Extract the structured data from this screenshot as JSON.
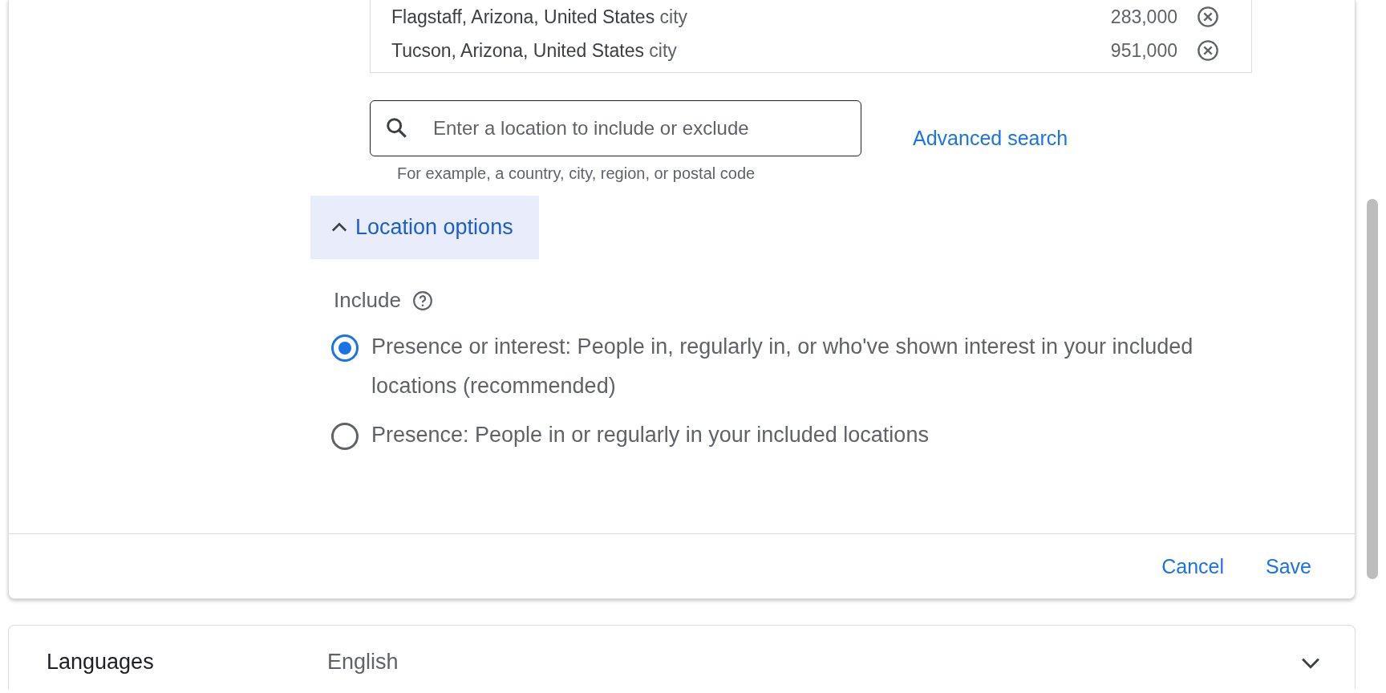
{
  "locations": [
    {
      "name": "Flagstaff, Arizona, United States",
      "type": "city",
      "reach": "283,000"
    },
    {
      "name": "Tucson, Arizona, United States",
      "type": "city",
      "reach": "951,000"
    }
  ],
  "search": {
    "placeholder": "Enter a location to include or exclude",
    "helper": "For example, a country, city, region, or postal code"
  },
  "advanced_search": "Advanced search",
  "location_options": {
    "label": "Location options",
    "expanded": true
  },
  "include": {
    "label": "Include",
    "options": [
      {
        "label": "Presence or interest: People in, regularly in, or who've shown interest in your included locations (recommended)",
        "selected": true
      },
      {
        "label": "Presence: People in or regularly in your included locations",
        "selected": false
      }
    ]
  },
  "buttons": [
    "Cancel",
    "Save"
  ],
  "languages": {
    "label": "Languages",
    "value": "English"
  }
}
